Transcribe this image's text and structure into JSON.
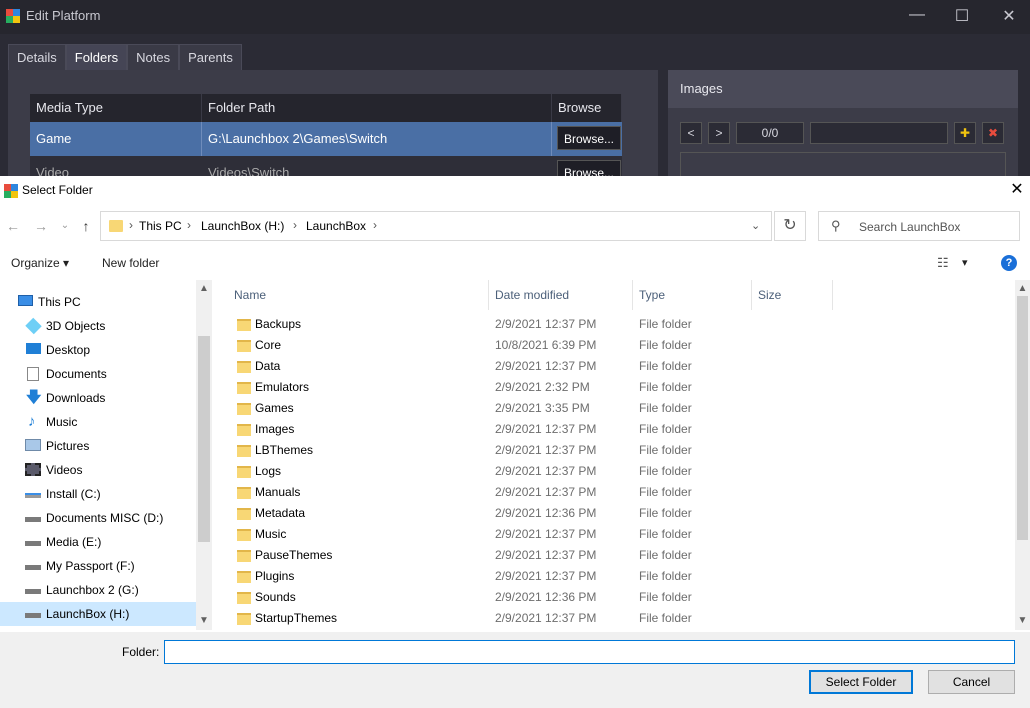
{
  "bg": {
    "title": "Edit Platform",
    "controls": {
      "minimize": "—",
      "maximize": "☐",
      "close": "✕"
    },
    "tabs": [
      "Details",
      "Folders",
      "Notes",
      "Parents"
    ],
    "active_tab": "Folders",
    "table": {
      "headers": [
        "Media Type",
        "Folder Path",
        "Browse"
      ],
      "rows": [
        {
          "media": "Game",
          "path": "G:\\Launchbox 2\\Games\\Switch",
          "browse": "Browse..."
        },
        {
          "media": "Video",
          "path": "Videos\\Switch",
          "browse": "Browse..."
        }
      ]
    },
    "images": {
      "title": "Images",
      "prev": "<",
      "next": ">",
      "counter": "0/0"
    },
    "colors": {
      "selected_row": "#4a6fa5",
      "panel": "#3c3c48"
    }
  },
  "dialog": {
    "title": "Select Folder",
    "close": "✕",
    "nav": {
      "back": "←",
      "forward": "→",
      "recent": "⌄",
      "up": "↑"
    },
    "breadcrumb": [
      "This PC",
      "LaunchBox (H:)",
      "LaunchBox"
    ],
    "refresh": "↻",
    "search_placeholder": "Search LaunchBox",
    "toolbar": {
      "organize": "Organize ▾",
      "new_folder": "New folder",
      "view": "▾",
      "help": "?"
    },
    "nav_pane": [
      {
        "label": "This PC",
        "icon": "pc-icon"
      },
      {
        "label": "3D Objects",
        "icon": "3d-objects-icon"
      },
      {
        "label": "Desktop",
        "icon": "desktop-icon"
      },
      {
        "label": "Documents",
        "icon": "documents-icon"
      },
      {
        "label": "Downloads",
        "icon": "downloads-icon"
      },
      {
        "label": "Music",
        "icon": "music-icon"
      },
      {
        "label": "Pictures",
        "icon": "pictures-icon"
      },
      {
        "label": "Videos",
        "icon": "videos-icon"
      },
      {
        "label": "Install (C:)",
        "icon": "drive-c-icon"
      },
      {
        "label": "Documents MISC (D:)",
        "icon": "drive-icon"
      },
      {
        "label": "Media (E:)",
        "icon": "drive-icon"
      },
      {
        "label": "My Passport (F:)",
        "icon": "drive-icon"
      },
      {
        "label": "Launchbox 2 (G:)",
        "icon": "drive-icon"
      },
      {
        "label": "LaunchBox (H:)",
        "icon": "drive-icon"
      }
    ],
    "selected_nav": "LaunchBox (H:)",
    "columns": [
      "Name",
      "Date modified",
      "Type",
      "Size"
    ],
    "files": [
      {
        "name": "Backups",
        "date": "2/9/2021 12:37 PM",
        "type": "File folder"
      },
      {
        "name": "Core",
        "date": "10/8/2021 6:39 PM",
        "type": "File folder"
      },
      {
        "name": "Data",
        "date": "2/9/2021 12:37 PM",
        "type": "File folder"
      },
      {
        "name": "Emulators",
        "date": "2/9/2021 2:32 PM",
        "type": "File folder"
      },
      {
        "name": "Games",
        "date": "2/9/2021 3:35 PM",
        "type": "File folder"
      },
      {
        "name": "Images",
        "date": "2/9/2021 12:37 PM",
        "type": "File folder"
      },
      {
        "name": "LBThemes",
        "date": "2/9/2021 12:37 PM",
        "type": "File folder"
      },
      {
        "name": "Logs",
        "date": "2/9/2021 12:37 PM",
        "type": "File folder"
      },
      {
        "name": "Manuals",
        "date": "2/9/2021 12:37 PM",
        "type": "File folder"
      },
      {
        "name": "Metadata",
        "date": "2/9/2021 12:36 PM",
        "type": "File folder"
      },
      {
        "name": "Music",
        "date": "2/9/2021 12:37 PM",
        "type": "File folder"
      },
      {
        "name": "PauseThemes",
        "date": "2/9/2021 12:37 PM",
        "type": "File folder"
      },
      {
        "name": "Plugins",
        "date": "2/9/2021 12:37 PM",
        "type": "File folder"
      },
      {
        "name": "Sounds",
        "date": "2/9/2021 12:36 PM",
        "type": "File folder"
      },
      {
        "name": "StartupThemes",
        "date": "2/9/2021 12:37 PM",
        "type": "File folder"
      }
    ],
    "folder_label": "Folder:",
    "folder_value": "",
    "select_button": "Select Folder",
    "cancel_button": "Cancel",
    "colors": {
      "accent": "#0078d7",
      "selection": "#cce8ff",
      "folder": "#f8d775"
    }
  }
}
